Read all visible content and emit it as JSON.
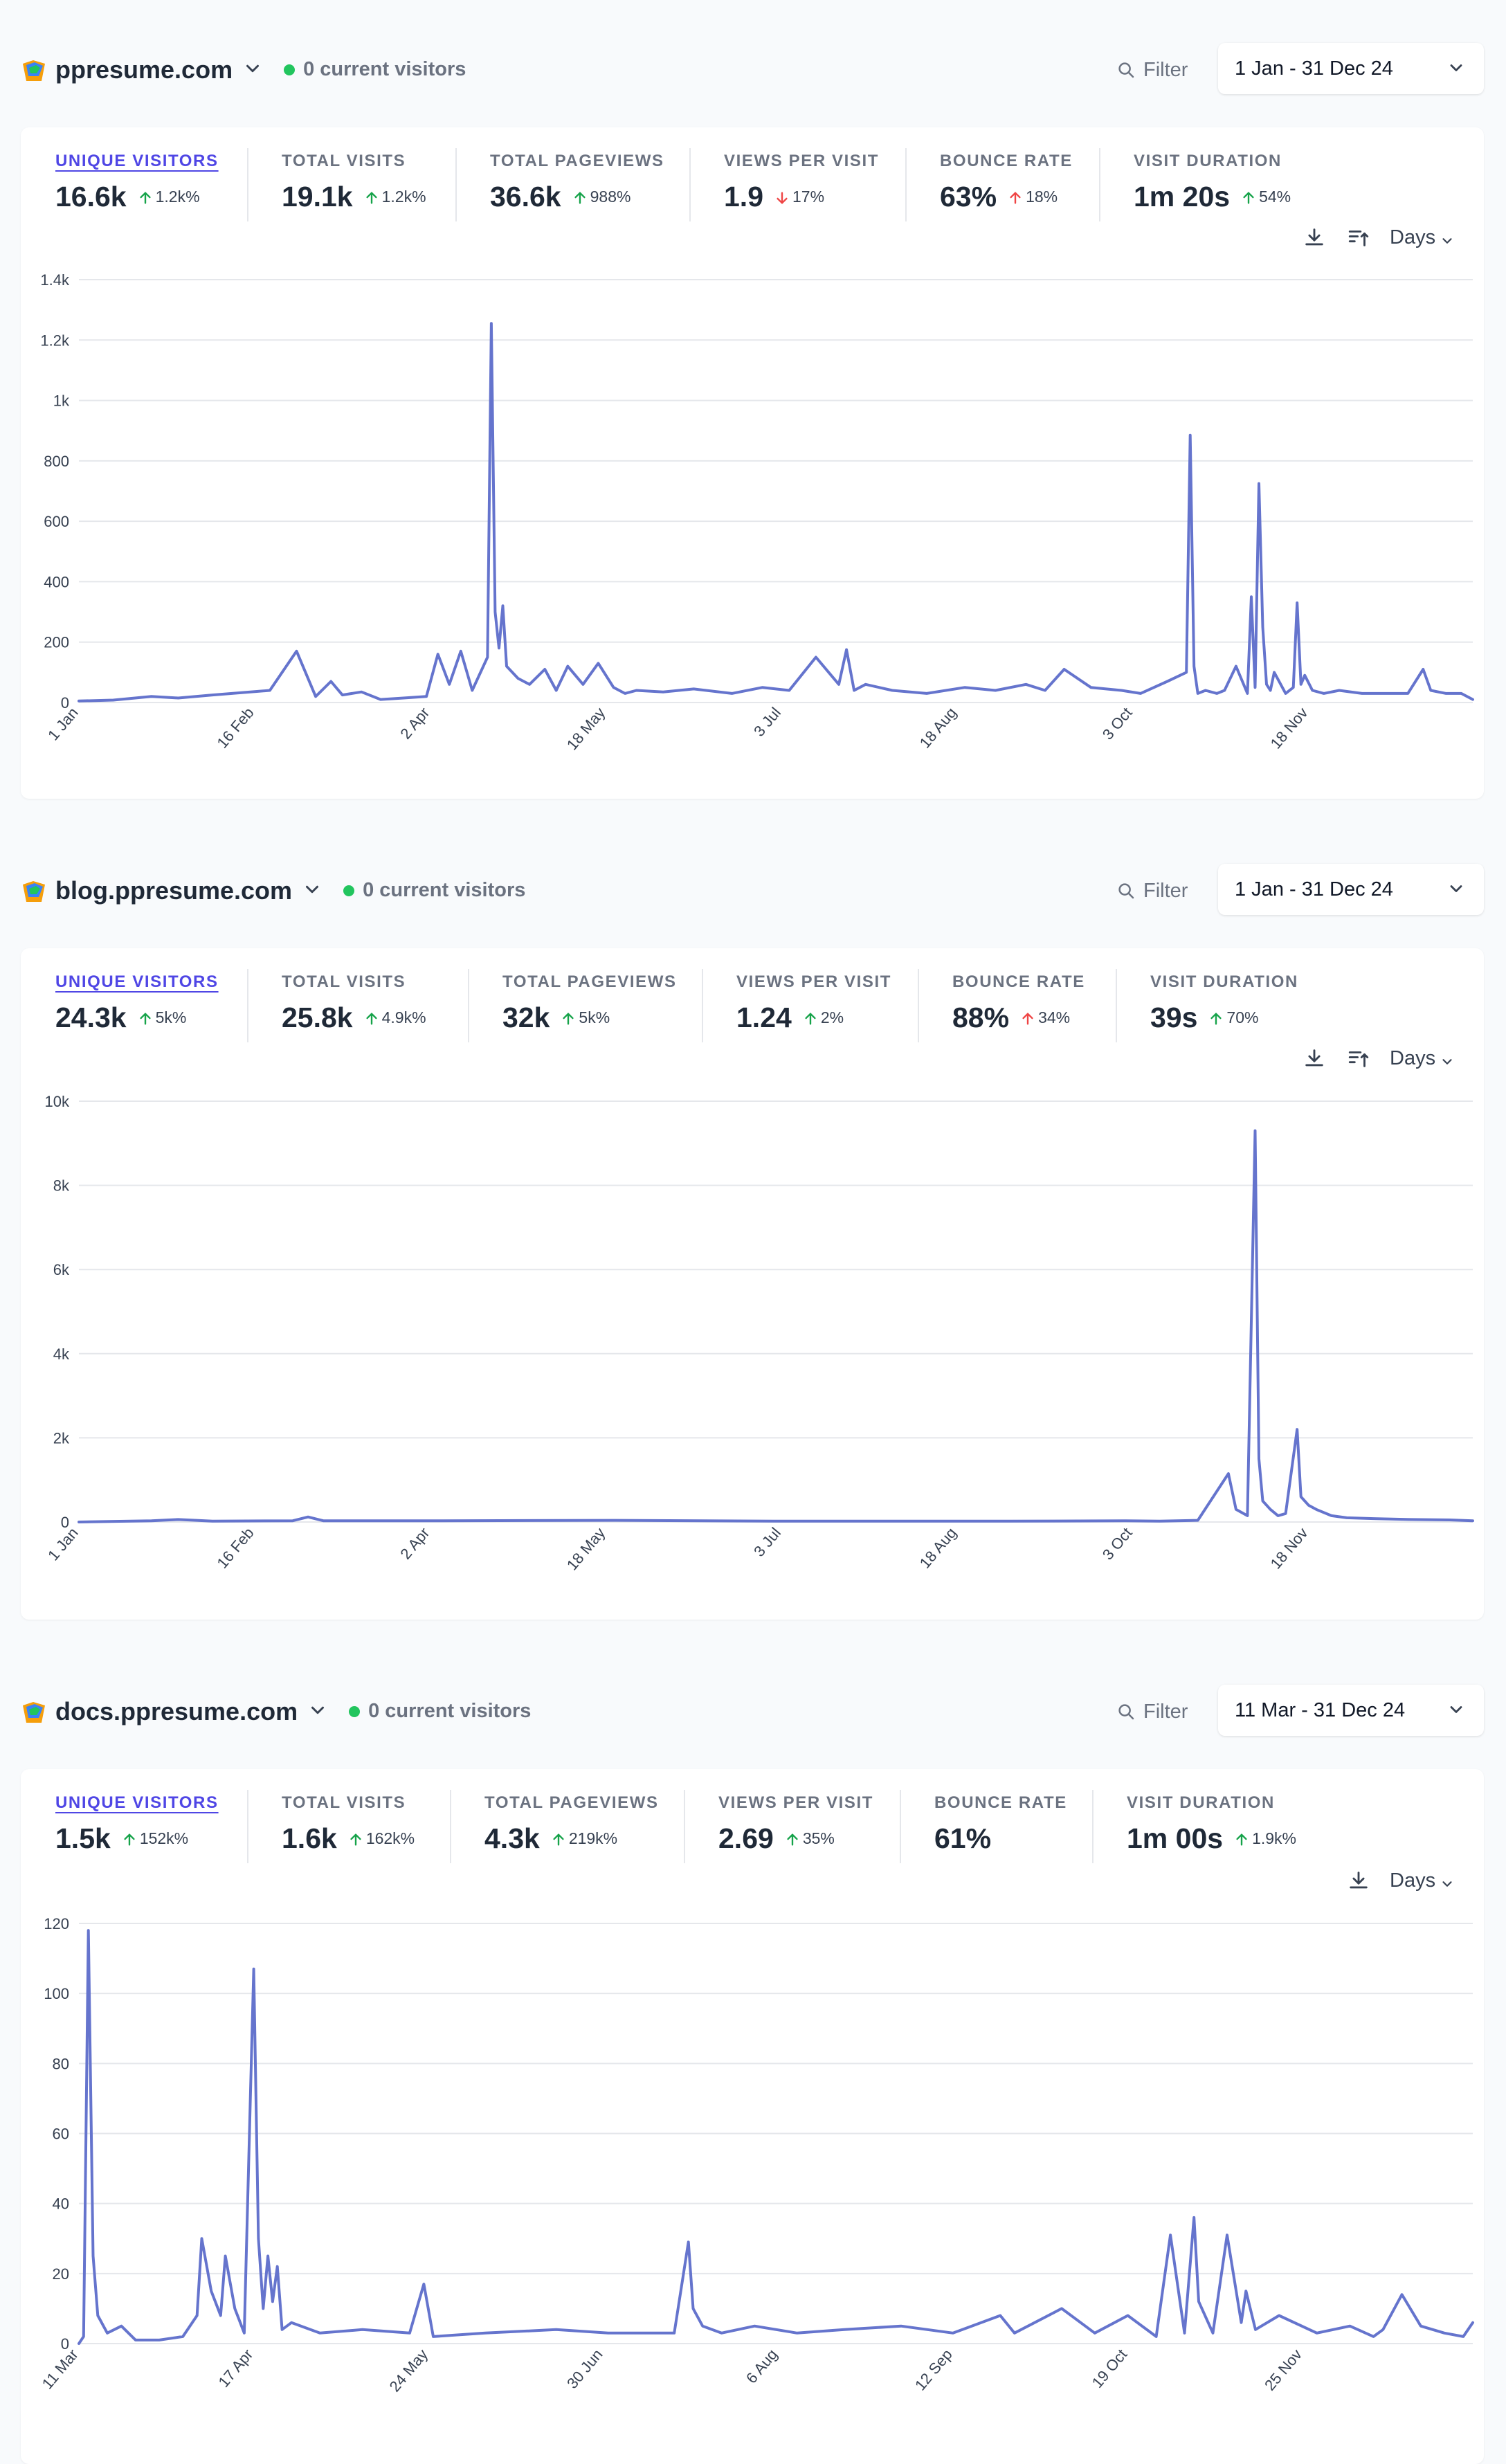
{
  "sites": [
    {
      "domain": "ppresume.com",
      "current_visitors": "0 current visitors",
      "filter_label": "Filter",
      "date_range": "1 Jan - 31 Dec 24",
      "metrics": [
        {
          "label": "UNIQUE VISITORS",
          "value": "16.6k",
          "change": "1.2k%",
          "direction": "up"
        },
        {
          "label": "TOTAL VISITS",
          "value": "19.1k",
          "change": "1.2k%",
          "direction": "up"
        },
        {
          "label": "TOTAL PAGEVIEWS",
          "value": "36.6k",
          "change": "988%",
          "direction": "up"
        },
        {
          "label": "VIEWS PER VISIT",
          "value": "1.9",
          "change": "17%",
          "direction": "down"
        },
        {
          "label": "BOUNCE RATE",
          "value": "63%",
          "change": "18%",
          "direction": "up-red"
        },
        {
          "label": "VISIT DURATION",
          "value": "1m 20s",
          "change": "54%",
          "direction": "up"
        }
      ],
      "interval_label": "Days",
      "tools": [
        "download-icon",
        "sort-icon"
      ]
    },
    {
      "domain": "blog.ppresume.com",
      "current_visitors": "0 current visitors",
      "filter_label": "Filter",
      "date_range": "1 Jan - 31 Dec 24",
      "metrics": [
        {
          "label": "UNIQUE VISITORS",
          "value": "24.3k",
          "change": "5k%",
          "direction": "up"
        },
        {
          "label": "TOTAL VISITS",
          "value": "25.8k",
          "change": "4.9k%",
          "direction": "up"
        },
        {
          "label": "TOTAL PAGEVIEWS",
          "value": "32k",
          "change": "5k%",
          "direction": "up"
        },
        {
          "label": "VIEWS PER VISIT",
          "value": "1.24",
          "change": "2%",
          "direction": "up"
        },
        {
          "label": "BOUNCE RATE",
          "value": "88%",
          "change": "34%",
          "direction": "up-red"
        },
        {
          "label": "VISIT DURATION",
          "value": "39s",
          "change": "70%",
          "direction": "up"
        }
      ],
      "interval_label": "Days",
      "tools": [
        "download-icon",
        "sort-icon"
      ]
    },
    {
      "domain": "docs.ppresume.com",
      "current_visitors": "0 current visitors",
      "filter_label": "Filter",
      "date_range": "11 Mar - 31 Dec 24",
      "metrics": [
        {
          "label": "UNIQUE VISITORS",
          "value": "1.5k",
          "change": "152k%",
          "direction": "up"
        },
        {
          "label": "TOTAL VISITS",
          "value": "1.6k",
          "change": "162k%",
          "direction": "up"
        },
        {
          "label": "TOTAL PAGEVIEWS",
          "value": "4.3k",
          "change": "219k%",
          "direction": "up"
        },
        {
          "label": "VIEWS PER VISIT",
          "value": "2.69",
          "change": "35%",
          "direction": "up"
        },
        {
          "label": "BOUNCE RATE",
          "value": "61%",
          "change": "",
          "direction": "none"
        },
        {
          "label": "VISIT DURATION",
          "value": "1m 00s",
          "change": "1.9k%",
          "direction": "up"
        }
      ],
      "interval_label": "Days",
      "tools": [
        "download-icon"
      ]
    }
  ],
  "colors": {
    "line": "#6574cd",
    "accent": "#4f46e5",
    "live": "#22c55e",
    "up": "#16a34a",
    "down": "#ef4444"
  },
  "chart_data": [
    {
      "type": "line",
      "series_label": "UNIQUE VISITORS",
      "x_start": "2024-01-01",
      "x_end": "2024-12-31",
      "xlim": [
        "2024-01-01",
        "2024-12-31"
      ],
      "ylim": [
        0,
        1400
      ],
      "yticks": [
        0,
        200,
        400,
        600,
        800,
        1000,
        1200,
        1400
      ],
      "ytick_labels": [
        "0",
        "200",
        "400",
        "600",
        "800",
        "1k",
        "1.2k",
        "1.4k"
      ],
      "xtick_labels": [
        "1 Jan",
        "16 Feb",
        "2 Apr",
        "18 May",
        "3 Jul",
        "18 Aug",
        "3 Oct",
        "18 Nov"
      ],
      "xtick_dates": [
        "2024-01-01",
        "2024-02-16",
        "2024-04-02",
        "2024-05-18",
        "2024-07-03",
        "2024-08-18",
        "2024-10-03",
        "2024-11-18"
      ],
      "grid": true,
      "x": [
        "2024-01-01",
        "2024-01-10",
        "2024-01-20",
        "2024-01-27",
        "2024-02-05",
        "2024-02-20",
        "2024-02-27",
        "2024-03-03",
        "2024-03-07",
        "2024-03-10",
        "2024-03-15",
        "2024-03-20",
        "2024-03-26",
        "2024-04-01",
        "2024-04-04",
        "2024-04-07",
        "2024-04-10",
        "2024-04-13",
        "2024-04-17",
        "2024-04-18",
        "2024-04-19",
        "2024-04-20",
        "2024-04-21",
        "2024-04-22",
        "2024-04-25",
        "2024-04-28",
        "2024-05-02",
        "2024-05-05",
        "2024-05-08",
        "2024-05-12",
        "2024-05-16",
        "2024-05-20",
        "2024-05-23",
        "2024-05-26",
        "2024-06-02",
        "2024-06-10",
        "2024-06-20",
        "2024-06-28",
        "2024-07-05",
        "2024-07-12",
        "2024-07-18",
        "2024-07-20",
        "2024-07-22",
        "2024-07-25",
        "2024-08-01",
        "2024-08-10",
        "2024-08-20",
        "2024-08-28",
        "2024-09-05",
        "2024-09-10",
        "2024-09-15",
        "2024-09-22",
        "2024-09-30",
        "2024-10-05",
        "2024-10-12",
        "2024-10-17",
        "2024-10-18",
        "2024-10-19",
        "2024-10-20",
        "2024-10-22",
        "2024-10-25",
        "2024-10-27",
        "2024-10-30",
        "2024-11-02",
        "2024-11-03",
        "2024-11-04",
        "2024-11-05",
        "2024-11-06",
        "2024-11-07",
        "2024-11-08",
        "2024-11-09",
        "2024-11-12",
        "2024-11-14",
        "2024-11-15",
        "2024-11-16",
        "2024-11-17",
        "2024-11-19",
        "2024-11-22",
        "2024-11-26",
        "2024-12-02",
        "2024-12-08",
        "2024-12-14",
        "2024-12-18",
        "2024-12-20",
        "2024-12-24",
        "2024-12-28",
        "2024-12-31"
      ],
      "y": [
        5,
        8,
        20,
        15,
        25,
        40,
        170,
        20,
        70,
        25,
        35,
        10,
        15,
        20,
        160,
        60,
        170,
        40,
        150,
        1255,
        300,
        180,
        320,
        120,
        80,
        60,
        110,
        40,
        120,
        60,
        130,
        50,
        30,
        40,
        35,
        45,
        30,
        50,
        40,
        150,
        60,
        175,
        40,
        60,
        40,
        30,
        50,
        40,
        60,
        40,
        110,
        50,
        40,
        30,
        70,
        100,
        885,
        120,
        30,
        40,
        30,
        40,
        120,
        30,
        350,
        50,
        725,
        250,
        60,
        40,
        100,
        30,
        50,
        330,
        60,
        90,
        40,
        30,
        40,
        30,
        30,
        30,
        110,
        40,
        30,
        30,
        10
      ]
    },
    {
      "type": "line",
      "series_label": "UNIQUE VISITORS",
      "x_start": "2024-01-01",
      "x_end": "2024-12-31",
      "xlim": [
        "2024-01-01",
        "2024-12-31"
      ],
      "ylim": [
        0,
        10000
      ],
      "yticks": [
        0,
        2000,
        4000,
        6000,
        8000,
        10000
      ],
      "ytick_labels": [
        "0",
        "2k",
        "4k",
        "6k",
        "8k",
        "10k"
      ],
      "xtick_labels": [
        "1 Jan",
        "16 Feb",
        "2 Apr",
        "18 May",
        "3 Jul",
        "18 Aug",
        "3 Oct",
        "18 Nov"
      ],
      "xtick_dates": [
        "2024-01-01",
        "2024-02-16",
        "2024-04-02",
        "2024-05-18",
        "2024-07-03",
        "2024-08-18",
        "2024-10-03",
        "2024-11-18"
      ],
      "grid": true,
      "x": [
        "2024-01-01",
        "2024-01-20",
        "2024-01-27",
        "2024-02-05",
        "2024-02-26",
        "2024-03-01",
        "2024-03-05",
        "2024-04-05",
        "2024-05-20",
        "2024-07-01",
        "2024-08-01",
        "2024-09-01",
        "2024-10-01",
        "2024-10-10",
        "2024-10-20",
        "2024-10-28",
        "2024-10-30",
        "2024-11-02",
        "2024-11-04",
        "2024-11-05",
        "2024-11-06",
        "2024-11-08",
        "2024-11-10",
        "2024-11-12",
        "2024-11-15",
        "2024-11-16",
        "2024-11-18",
        "2024-11-20",
        "2024-11-24",
        "2024-11-28",
        "2024-12-05",
        "2024-12-15",
        "2024-12-25",
        "2024-12-31"
      ],
      "y": [
        0,
        30,
        60,
        20,
        30,
        120,
        30,
        30,
        40,
        20,
        20,
        20,
        30,
        20,
        40,
        1150,
        300,
        150,
        9300,
        1500,
        500,
        300,
        150,
        200,
        2200,
        600,
        400,
        300,
        150,
        100,
        80,
        60,
        50,
        30
      ]
    },
    {
      "type": "line",
      "series_label": "UNIQUE VISITORS",
      "x_start": "2024-03-11",
      "x_end": "2024-12-31",
      "xlim": [
        "2024-03-11",
        "2024-12-31"
      ],
      "ylim": [
        0,
        120
      ],
      "yticks": [
        0,
        20,
        40,
        60,
        80,
        100,
        120
      ],
      "ytick_labels": [
        "0",
        "20",
        "40",
        "60",
        "80",
        "100",
        "120"
      ],
      "xtick_labels": [
        "11 Mar",
        "17 Apr",
        "24 May",
        "30 Jun",
        "6 Aug",
        "12 Sep",
        "19 Oct",
        "25 Nov"
      ],
      "xtick_dates": [
        "2024-03-11",
        "2024-04-17",
        "2024-05-24",
        "2024-06-30",
        "2024-08-06",
        "2024-09-12",
        "2024-10-19",
        "2024-11-25"
      ],
      "grid": true,
      "x": [
        "2024-03-11",
        "2024-03-12",
        "2024-03-13",
        "2024-03-14",
        "2024-03-15",
        "2024-03-17",
        "2024-03-20",
        "2024-03-23",
        "2024-03-28",
        "2024-04-02",
        "2024-04-05",
        "2024-04-06",
        "2024-04-08",
        "2024-04-10",
        "2024-04-11",
        "2024-04-13",
        "2024-04-15",
        "2024-04-17",
        "2024-04-18",
        "2024-04-19",
        "2024-04-20",
        "2024-04-21",
        "2024-04-22",
        "2024-04-23",
        "2024-04-25",
        "2024-05-01",
        "2024-05-10",
        "2024-05-20",
        "2024-05-23",
        "2024-05-25",
        "2024-06-05",
        "2024-06-20",
        "2024-07-01",
        "2024-07-15",
        "2024-07-18",
        "2024-07-19",
        "2024-07-21",
        "2024-07-25",
        "2024-08-01",
        "2024-08-10",
        "2024-08-20",
        "2024-09-01",
        "2024-09-12",
        "2024-09-22",
        "2024-09-25",
        "2024-10-05",
        "2024-10-12",
        "2024-10-19",
        "2024-10-25",
        "2024-10-28",
        "2024-10-31",
        "2024-11-02",
        "2024-11-03",
        "2024-11-06",
        "2024-11-09",
        "2024-11-12",
        "2024-11-13",
        "2024-11-15",
        "2024-11-20",
        "2024-11-28",
        "2024-12-05",
        "2024-12-10",
        "2024-12-12",
        "2024-12-16",
        "2024-12-20",
        "2024-12-25",
        "2024-12-29",
        "2024-12-31"
      ],
      "y": [
        0,
        2,
        118,
        25,
        8,
        3,
        5,
        1,
        1,
        2,
        8,
        30,
        15,
        8,
        25,
        10,
        3,
        107,
        30,
        10,
        25,
        12,
        22,
        4,
        6,
        3,
        4,
        3,
        17,
        2,
        3,
        4,
        3,
        3,
        29,
        10,
        5,
        3,
        5,
        3,
        4,
        5,
        3,
        8,
        3,
        10,
        3,
        8,
        2,
        31,
        3,
        36,
        12,
        3,
        31,
        6,
        15,
        4,
        8,
        3,
        5,
        2,
        4,
        14,
        5,
        3,
        2,
        6
      ]
    }
  ]
}
